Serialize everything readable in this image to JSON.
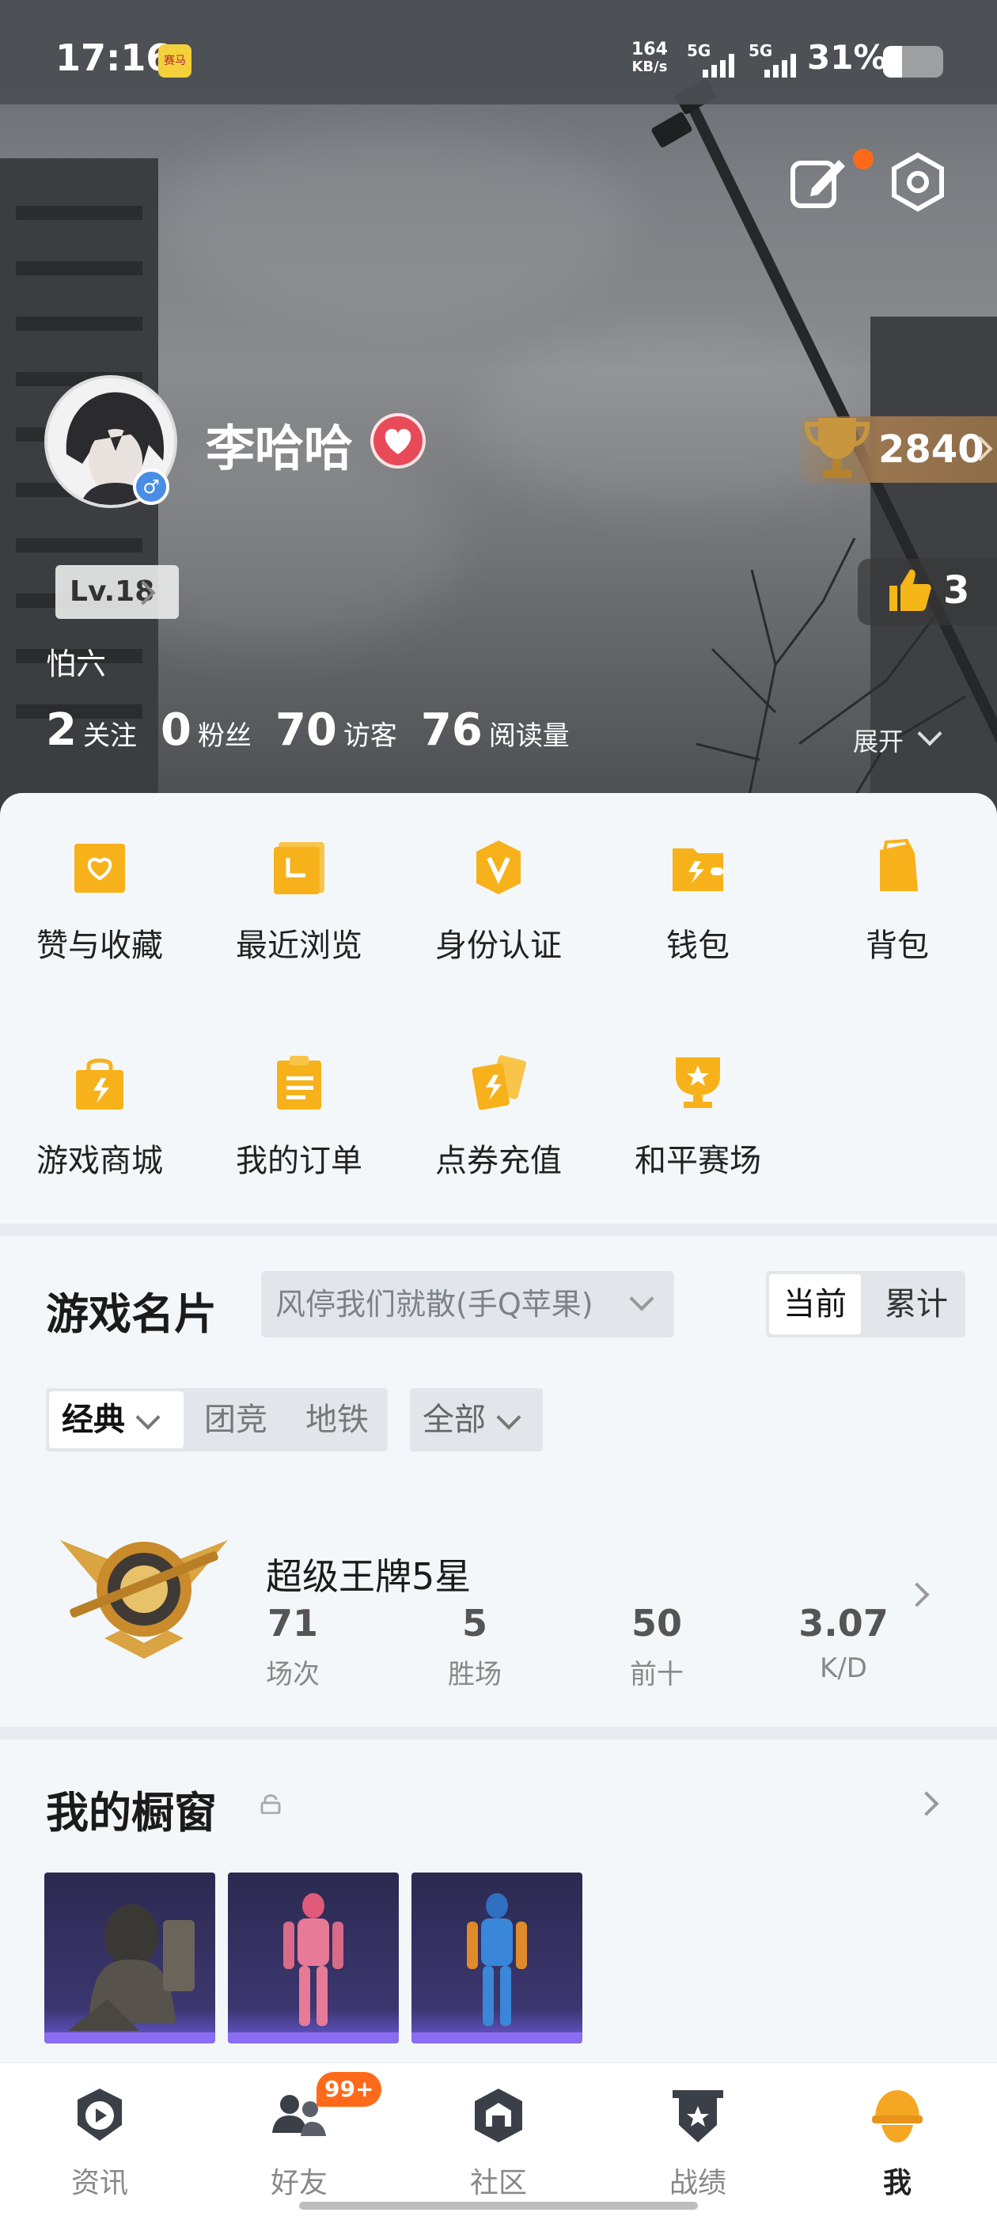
{
  "status_bar": {
    "time": "17:16",
    "app_badge": "赛马",
    "net_speed_value": "164",
    "net_speed_unit": "KB/s",
    "signal1": "5G",
    "signal2": "5G",
    "battery": "31%",
    "battery_level": 0.31
  },
  "profile": {
    "username": "李哈哈",
    "trophy_score": "2840",
    "level": "Lv.18",
    "likes": "3",
    "signature": "怕六",
    "stats": [
      {
        "num": "2",
        "label": "关注"
      },
      {
        "num": "0",
        "label": "粉丝"
      },
      {
        "num": "70",
        "label": "访客"
      },
      {
        "num": "76",
        "label": "阅读量"
      }
    ],
    "expand_label": "展开"
  },
  "grid": [
    {
      "label": "赞与收藏",
      "icon": "heart-folder-icon"
    },
    {
      "label": "最近浏览",
      "icon": "history-folder-icon"
    },
    {
      "label": "身份认证",
      "icon": "verified-badge-icon"
    },
    {
      "label": "钱包",
      "icon": "wallet-icon"
    },
    {
      "label": "背包",
      "icon": "backpack-icon"
    },
    {
      "label": "游戏商城",
      "icon": "shopping-bag-icon"
    },
    {
      "label": "我的订单",
      "icon": "clipboard-icon"
    },
    {
      "label": "点券充值",
      "icon": "coupon-cards-icon"
    },
    {
      "label": "和平赛场",
      "icon": "trophy-star-icon"
    }
  ],
  "game_card": {
    "title": "游戏名片",
    "server": "风停我们就散(手Q苹果)",
    "toggle_current": "当前",
    "toggle_total": "累计",
    "mode_classic": "经典",
    "mode_team": "团竞",
    "mode_metro": "地铁",
    "filter_all": "全部",
    "rank_title": "超级王牌5星",
    "rank_stats": [
      {
        "value": "71",
        "label": "场次"
      },
      {
        "value": "5",
        "label": "胜场"
      },
      {
        "value": "50",
        "label": "前十"
      },
      {
        "value": "3.07",
        "label": "K/D"
      }
    ]
  },
  "showcase": {
    "title": "我的橱窗"
  },
  "bottom_nav": {
    "items": [
      {
        "label": "资讯",
        "icon": "news-play-icon"
      },
      {
        "label": "好友",
        "icon": "friends-icon"
      },
      {
        "label": "社区",
        "icon": "community-hex-icon"
      },
      {
        "label": "战绩",
        "icon": "record-shield-icon"
      },
      {
        "label": "我",
        "icon": "helmet-avatar-icon"
      }
    ],
    "friends_badge": "99+"
  },
  "colors": {
    "accent_orange": "#ff6a1a",
    "icon_yellow": "#f7b21b",
    "active_tab": "#f5a623"
  }
}
